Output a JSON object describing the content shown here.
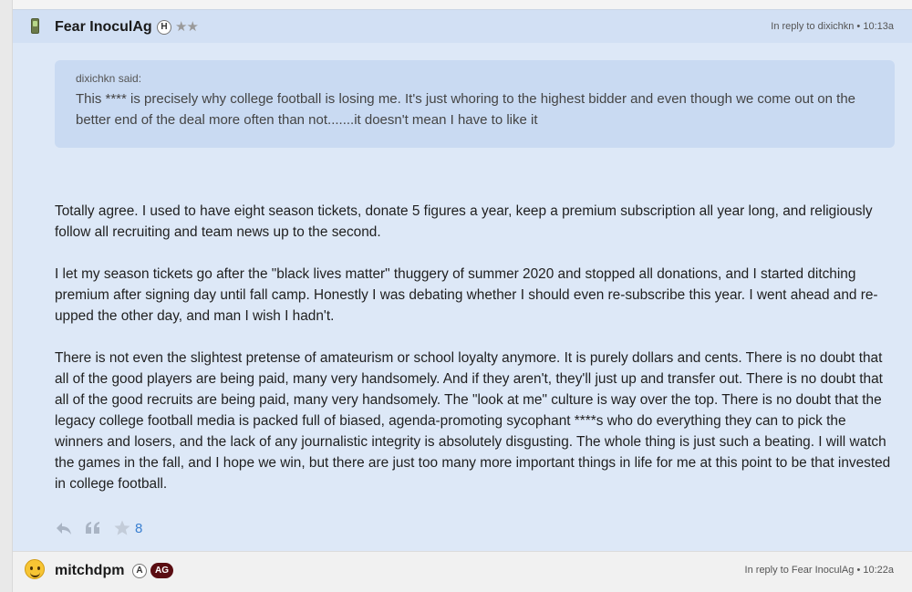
{
  "post": {
    "username": "Fear InoculAg",
    "badge": "H",
    "stars": "★★",
    "reply_meta": "In reply to dixichkn • 10:13a",
    "quote": {
      "author": "dixichkn said:",
      "text": "This **** is precisely why college football is losing me. It's just whoring to the highest bidder and even though we come out on the better end of the deal more often than not.......it doesn't mean I have to like it"
    },
    "paragraphs": [
      "Totally agree. I used to have eight season tickets, donate 5 figures a year, keep a premium subscription all year long, and religiously follow all recruiting and team news up to the second.",
      "I let my season tickets go after the \"black lives matter\" thuggery of summer 2020 and stopped all donations, and I started ditching premium after signing day until fall camp. Honestly I was debating whether I should even re-subscribe this year. I went ahead and re-upped the other day, and man I wish I hadn't.",
      "There is not even the slightest pretense of amateurism or school loyalty anymore. It is purely dollars and cents. There is no doubt that all of the good players are being paid, many very handsomely. And if they aren't, they'll just up and transfer out. There is no doubt that all of the good recruits are being paid, many very handsomely. The \"look at me\" culture is way over the top. There is no doubt that the legacy college football media is packed full of biased, agenda-promoting sycophant ****s who do everything they can to pick the winners and losers, and the lack of any journalistic integrity is absolutely disgusting. The whole thing is just such a beating. I will watch the games in the fall, and I hope we win, but there are just too many more important things in life for me at this point to be that invested in college football."
    ],
    "like_count": "8"
  },
  "next_post": {
    "username": "mitchdpm",
    "badge_a": "A",
    "badge_ag": "AG",
    "reply_meta": "In reply to Fear InoculAg • 10:22a"
  },
  "icons": {
    "reply": "reply-arrow-icon",
    "quote": "quote-icon",
    "like": "star-icon"
  },
  "colors": {
    "post_bg": "#dde8f7",
    "quote_bg": "#c9daf2",
    "like_count": "#3a7fd0",
    "ag_badge": "#5a0d12"
  }
}
